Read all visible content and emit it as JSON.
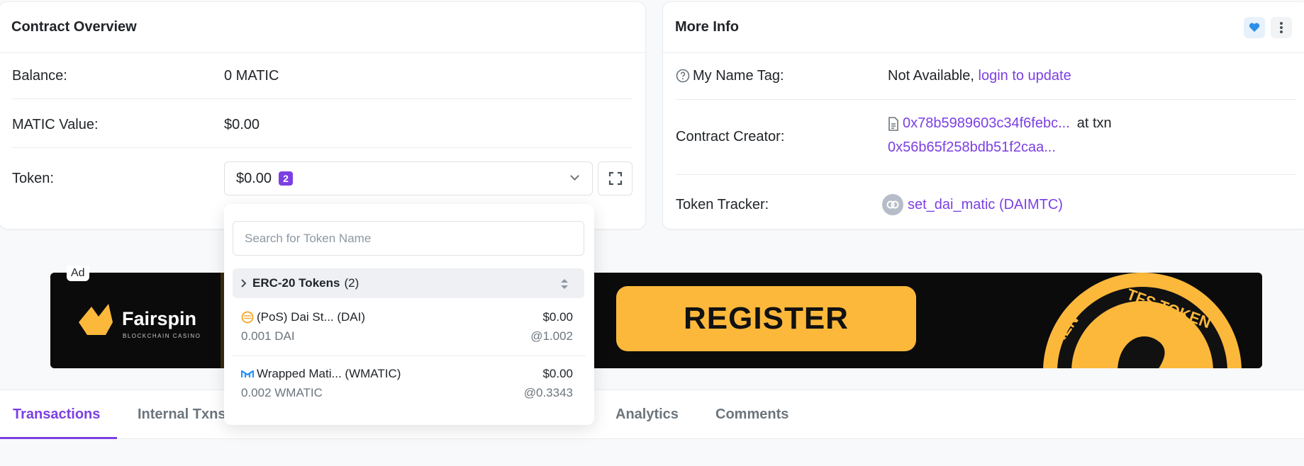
{
  "overview": {
    "title": "Contract Overview",
    "balance_label": "Balance:",
    "balance_value": "0 MATIC",
    "matic_value_label": "MATIC Value:",
    "matic_value": "$0.00",
    "token_label": "Token:",
    "token_value": "$0.00",
    "token_count": "2"
  },
  "dropdown": {
    "search_placeholder": "Search for Token Name",
    "group_name": "ERC-20 Tokens",
    "group_count": "(2)",
    "items": [
      {
        "name": "(PoS) Dai St... (DAI)",
        "usd": "$0.00",
        "amount": "0.001 DAI",
        "rate": "@1.002",
        "icon": "dai-icon",
        "color": "#f5ac37"
      },
      {
        "name": "Wrapped Mati... (WMATIC)",
        "usd": "$0.00",
        "amount": "0.002 WMATIC",
        "rate": "@0.3343",
        "icon": "matic-icon",
        "color": "#2891f9"
      }
    ]
  },
  "more_info": {
    "title": "More Info",
    "name_tag_label": "My Name Tag:",
    "name_tag_value": "Not Available,",
    "name_tag_link": "login to update",
    "creator_label": "Contract Creator:",
    "creator_address": "0x78b5989603c34f6febc...",
    "creator_at_txn": "at txn",
    "creator_txn": "0x56b65f258bdb51f2caa...",
    "tracker_label": "Token Tracker:",
    "tracker_value": "set_dai_matic (DAIMTC)"
  },
  "ad": {
    "tag": "Ad",
    "brand": "Fairspin",
    "brand_sub": "BLOCKCHAIN CASINO",
    "cta": "REGISTER",
    "coin_text": "TFS TOKEN",
    "coin_text_left": "OKEN"
  },
  "tabs": [
    "Transactions",
    "Internal Txns",
    "Analytics",
    "Comments"
  ],
  "colors": {
    "accent": "#7b3fe4",
    "ad_yellow": "#fcb83b"
  }
}
